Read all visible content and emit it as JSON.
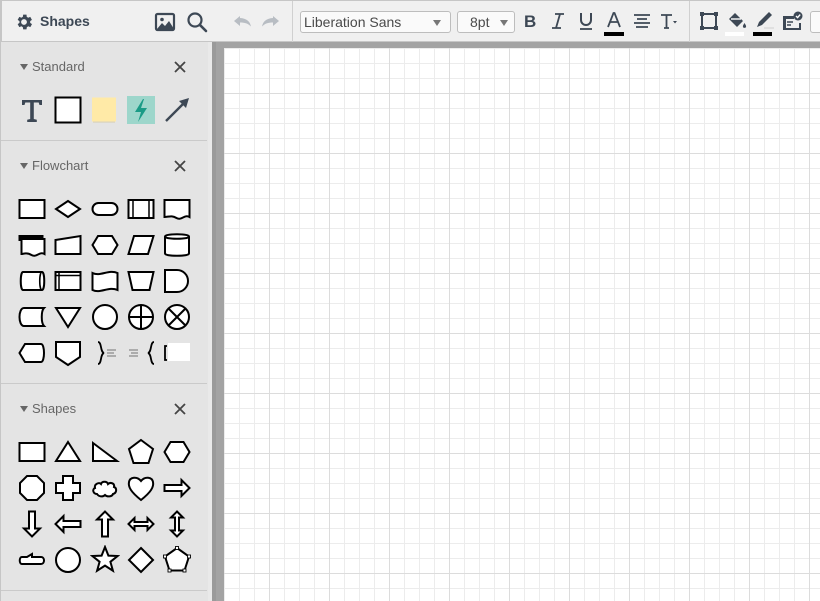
{
  "sidebar": {
    "header": {
      "title": "Shapes",
      "icons": [
        "gear-icon",
        "image-icon",
        "search-icon"
      ]
    },
    "sections": [
      {
        "title": "Standard",
        "shapes": [
          "text",
          "rectangle",
          "note",
          "hotspot",
          "arrow-line"
        ]
      },
      {
        "title": "Flowchart",
        "shapes": [
          "process",
          "decision",
          "terminator",
          "predefined-process",
          "document",
          "multiple-documents",
          "manual-input",
          "preparation",
          "data",
          "database",
          "direct-access-storage",
          "internal-storage",
          "paper-tape",
          "manual-operation",
          "delay",
          "stored-data",
          "merge",
          "connector",
          "or",
          "summing-junction",
          "display",
          "off-page-link",
          "annotation-right-brace",
          "annotation-left-brace",
          "annotation-bracket"
        ]
      },
      {
        "title": "Shapes",
        "shapes": [
          "rectangle",
          "triangle",
          "right-triangle",
          "pentagon",
          "hexagon",
          "octagon",
          "cross",
          "cloud",
          "heart",
          "arrow-right",
          "arrow-down",
          "arrow-left",
          "arrow-up",
          "arrow-left-right",
          "arrow-up-down",
          "callout",
          "circle",
          "star",
          "diamond",
          "polygon"
        ]
      }
    ]
  },
  "toolbar": {
    "undo": "undo-icon",
    "redo": "redo-icon",
    "font_family": "Liberation Sans",
    "font_size": "8pt",
    "bold": "B",
    "italic": "I",
    "underline": "U",
    "text_color_label": "A",
    "colors": {
      "text_color": "#000000",
      "fill_color": "#ffffff",
      "line_color": "#000000",
      "hotspot_fill": "#9dd6cb",
      "hotspot_bolt": "#1a9b86",
      "note_fill": "#ffeaa7",
      "icon_color": "#3d4855"
    }
  }
}
